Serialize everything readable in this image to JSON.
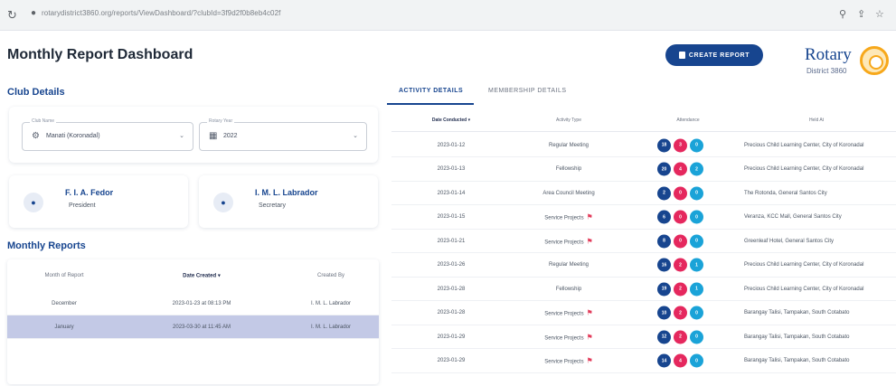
{
  "browser": {
    "reload_icon": "reload-icon",
    "url": "rotarydistrict3860.org/reports/ViewDashboard/?clubId=3f9d2f0b8eb4c02f",
    "right_icons": [
      "zoom-icon",
      "share-icon",
      "star-icon"
    ]
  },
  "header": {
    "title": "Monthly Report Dashboard",
    "create_button": "CREATE REPORT",
    "logo_word": "Rotary",
    "logo_district": "District 3860"
  },
  "club_details": {
    "title": "Club Details",
    "club_field": {
      "label": "Club Name",
      "value": "Manati (Koronadal)"
    },
    "year_field": {
      "label": "Rotary Year",
      "value": "2022"
    }
  },
  "officers": [
    {
      "name": "F. I. A. Fedor",
      "role": "President"
    },
    {
      "name": "I. M. L. Labrador",
      "role": "Secretary"
    }
  ],
  "monthly_reports": {
    "title": "Monthly Reports",
    "columns": [
      "Month of Report",
      "Date Created ▾",
      "Created By"
    ],
    "rows": [
      {
        "month": "December",
        "date": "2023-01-23 at 08:13 PM",
        "by": "I. M. L. Labrador"
      },
      {
        "month": "January",
        "date": "2023-03-30 at 11:45 AM",
        "by": "I. M. L. Labrador"
      }
    ]
  },
  "tabs": [
    "ACTIVITY DETAILS",
    "MEMBERSHIP DETAILS"
  ],
  "activity": {
    "columns": [
      "Date Conducted ▾",
      "Activity Type",
      "Attendance",
      "Held At"
    ],
    "rows": [
      {
        "date": "2023-01-12",
        "type": "Regular Meeting",
        "flag": false,
        "a": [
          "18",
          "3",
          "0"
        ],
        "venue": "Precious Child Learning Center, City of Koronadal"
      },
      {
        "date": "2023-01-13",
        "type": "Fellowship",
        "flag": false,
        "a": [
          "20",
          "4",
          "2"
        ],
        "venue": "Precious Child Learning Center, City of Koronadal"
      },
      {
        "date": "2023-01-14",
        "type": "Area Council Meeting",
        "flag": false,
        "a": [
          "2",
          "0",
          "0"
        ],
        "venue": "The Rotonda, General Santos City"
      },
      {
        "date": "2023-01-15",
        "type": "Service Projects",
        "flag": true,
        "a": [
          "6",
          "0",
          "0"
        ],
        "venue": "Veranza, KCC Mall, General Santos City"
      },
      {
        "date": "2023-01-21",
        "type": "Service Projects",
        "flag": true,
        "a": [
          "8",
          "0",
          "0"
        ],
        "venue": "Greenleaf Hotel, General Santos City"
      },
      {
        "date": "2023-01-26",
        "type": "Regular Meeting",
        "flag": false,
        "a": [
          "16",
          "2",
          "1"
        ],
        "venue": "Precious Child Learning Center, City of Koronadal"
      },
      {
        "date": "2023-01-28",
        "type": "Fellowship",
        "flag": false,
        "a": [
          "19",
          "2",
          "1"
        ],
        "venue": "Precious Child Learning Center, City of Koronadal"
      },
      {
        "date": "2023-01-28",
        "type": "Service Projects",
        "flag": true,
        "a": [
          "10",
          "2",
          "0"
        ],
        "venue": "Barangay Talisi, Tampakan, South Cotabato"
      },
      {
        "date": "2023-01-29",
        "type": "Service Projects",
        "flag": true,
        "a": [
          "12",
          "2",
          "0"
        ],
        "venue": "Barangay Talisi, Tampakan, South Cotabato"
      },
      {
        "date": "2023-01-29",
        "type": "Service Projects",
        "flag": true,
        "a": [
          "14",
          "4",
          "0"
        ],
        "venue": "Barangay Talisi, Tampakan, South Cotabato"
      }
    ]
  },
  "colors": {
    "accent": "#17458f",
    "pink": "#e5285e",
    "cyan": "#1aa3d8",
    "selected_row": "#c3c9e6",
    "gold": "#f7a81b"
  }
}
